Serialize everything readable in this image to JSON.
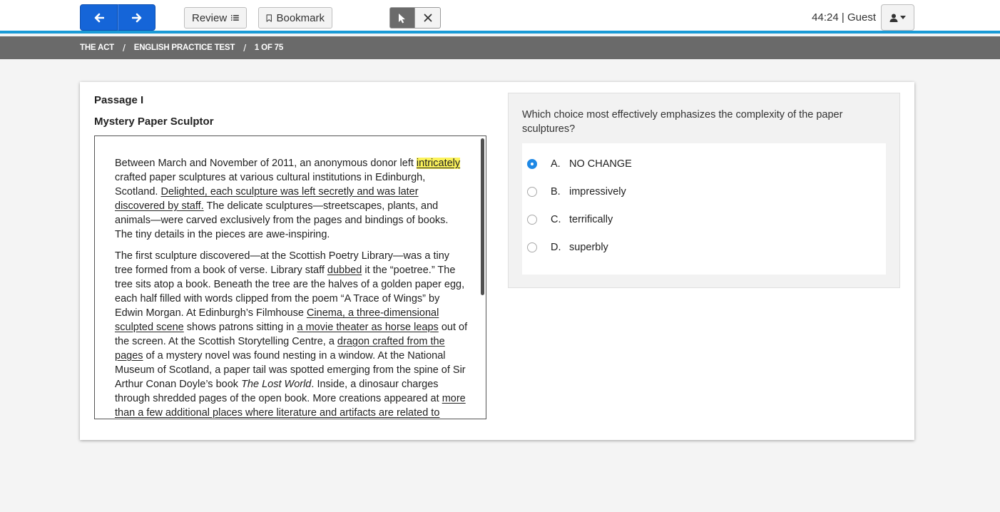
{
  "topbar": {
    "prev_icon": "arrow-left-icon",
    "next_icon": "arrow-right-icon",
    "review_label": "Review",
    "bookmark_label": "Bookmark",
    "timer": "44:24",
    "separator": "|",
    "user": "Guest"
  },
  "breadcrumb": {
    "items": [
      "THE ACT",
      "ENGLISH PRACTICE TEST",
      "1 OF 75"
    ],
    "separator": "/"
  },
  "passage": {
    "label": "Passage I",
    "title": "Mystery Paper Sculptor",
    "p1": {
      "s1": "Between March and November of 2011, an anonymous donor left ",
      "hl": "intricately",
      "s2": " crafted paper sculptures at various cultural institutions in Edinburgh, Scotland. ",
      "u1": "Delighted, each sculpture was left secretly and was later discovered by staff.",
      "s3": " The delicate sculptures—streetscapes, plants, and animals—were carved exclusively from the pages and bindings of books. The tiny details in the pieces are awe-inspiring."
    },
    "p2": {
      "s1": "The first sculpture discovered—at the Scottish Poetry Library—was a tiny tree formed from a book of verse. Library staff ",
      "u1": "dubbed",
      "s2": " it the “poetree.” The tree sits atop a book. Beneath the tree are the halves of a golden paper egg, each half filled with words clipped from the poem “A Trace of Wings” by Edwin Morgan. At Edinburgh’s Filmhouse ",
      "u2": "Cinema, a three-dimensional sculpted scene",
      "s3": " shows patrons sitting in ",
      "u3": "a movie theater as horse leaps",
      "s4": " out of the screen. At the Scottish Storytelling Centre, a ",
      "u4": "dragon crafted from the pages",
      "s5": " of a mystery novel was found nesting in a window. At the National Museum of Scotland, a paper tail was spotted emerging from the spine of Sir Arthur Conan Doyle’s book ",
      "i1": "The Lost World",
      "s6": ". Inside, a dinosaur charges through shredded pages of the open book. More creations appeared at ",
      "u5": "more than a few additional places where literature and artifacts are related to books and"
    }
  },
  "question": {
    "text": "Which choice most effectively emphasizes the complexity of the paper sculptures?",
    "choices": [
      {
        "letter": "A.",
        "text": "NO CHANGE",
        "selected": true
      },
      {
        "letter": "B.",
        "text": "impressively",
        "selected": false
      },
      {
        "letter": "C.",
        "text": "terrifically",
        "selected": false
      },
      {
        "letter": "D.",
        "text": "superbly",
        "selected": false
      }
    ]
  },
  "colors": {
    "accent": "#1565d8",
    "topbar_border": "#1a9ad6",
    "crumbbar": "#6a6a6a",
    "highlight": "#fbf25a",
    "radio_selected": "#1e88e5"
  }
}
